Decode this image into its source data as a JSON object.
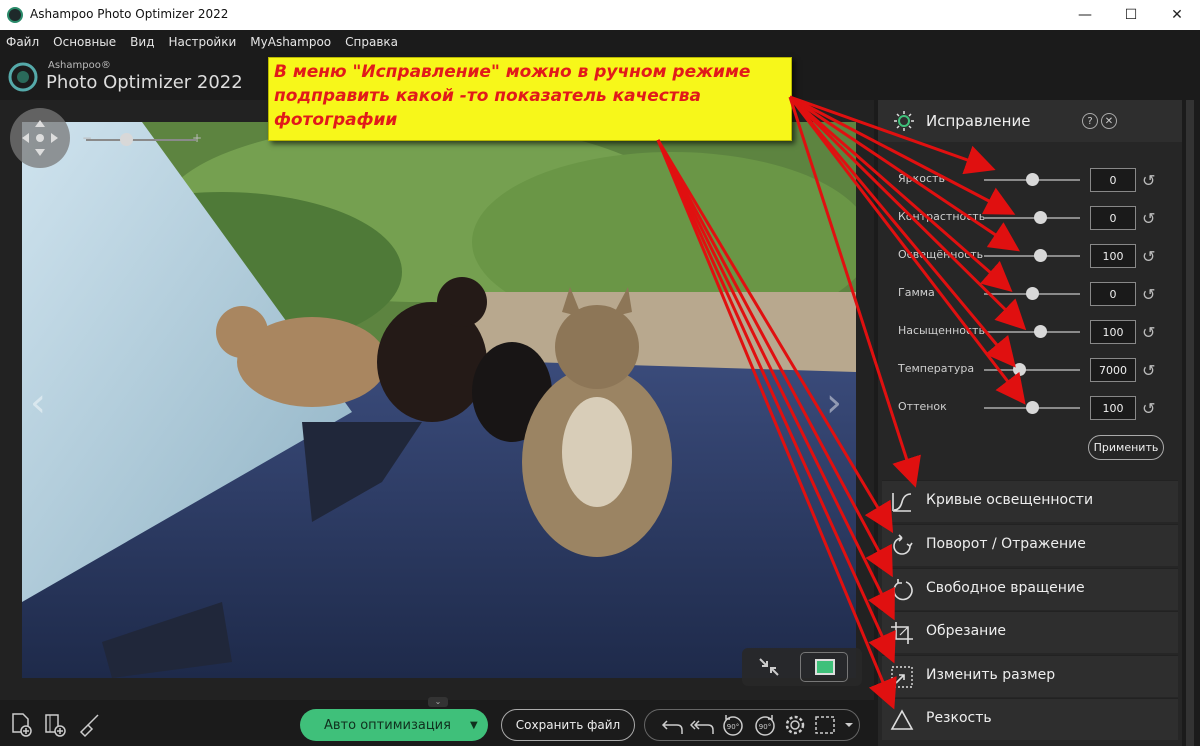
{
  "window": {
    "title": "Ashampoo Photo Optimizer 2022",
    "minimize": "—",
    "maximize": "☐",
    "close": "✕"
  },
  "menu": [
    "Файл",
    "Основные",
    "Вид",
    "Настройки",
    "MyAshampoo",
    "Справка"
  ],
  "brand": {
    "small": "Ashampoo®",
    "big": "Photo Optimizer 2022"
  },
  "zoom": {
    "minus": "−",
    "plus": "+",
    "level": 0.32
  },
  "nav": {
    "prev": "‹",
    "next": "›"
  },
  "panel": {
    "title": "Исправление",
    "help": "?",
    "close": "✕",
    "sliders": [
      {
        "label": "Яркость",
        "value": "0",
        "pos": 0.5
      },
      {
        "label": "Контрастность",
        "value": "0",
        "pos": 0.58
      },
      {
        "label": "Освещённость",
        "value": "100",
        "pos": 0.58
      },
      {
        "label": "Гамма",
        "value": "0",
        "pos": 0.5
      },
      {
        "label": "Насыщенность",
        "value": "100",
        "pos": 0.58
      },
      {
        "label": "Температура",
        "value": "7000",
        "pos": 0.36
      },
      {
        "label": "Оттенок",
        "value": "100",
        "pos": 0.5
      }
    ],
    "reset_glyph": "↺",
    "apply": "Применить",
    "tools": [
      {
        "label": "Кривые освещенности",
        "icon": "curves-icon"
      },
      {
        "label": "Поворот / Отражение",
        "icon": "rotate-flip-icon"
      },
      {
        "label": "Свободное вращение",
        "icon": "free-rotate-icon"
      },
      {
        "label": "Обрезание",
        "icon": "crop-icon"
      },
      {
        "label": "Изменить размер",
        "icon": "resize-icon"
      },
      {
        "label": "Резкость",
        "icon": "sharpen-icon"
      }
    ]
  },
  "bottom": {
    "auto": "Авто оптимизация",
    "auto_arrow": "▼",
    "save": "Сохранить файл",
    "collapse": "⌄"
  },
  "annotation": {
    "text": "В меню \"Исправление\" можно в ручном режиме подправить какой -то показатель качества фотографии"
  },
  "colors": {
    "accent": "#3fc07a",
    "callout_bg": "#f7f71a",
    "callout_text": "#e11a1a",
    "arrow": "#e01010"
  }
}
